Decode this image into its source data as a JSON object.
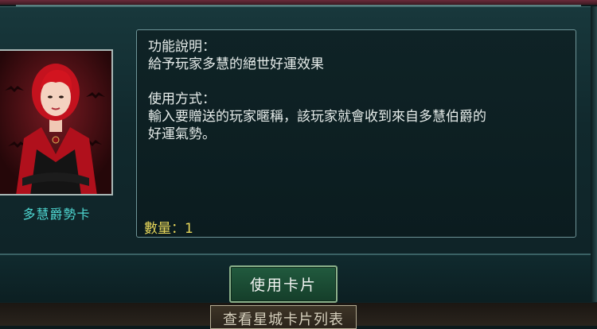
{
  "card": {
    "name": "多慧爵勢卡"
  },
  "description": {
    "function_title": "功能說明：",
    "function_text": "給予玩家多慧的絕世好運效果",
    "usage_title": "使用方式：",
    "usage_text_1": "輸入要贈送的玩家暱稱，該玩家就會收到來自多慧伯爵的",
    "usage_text_2": "好運氣勢。"
  },
  "quantity_label": "數量：1",
  "use_button_label": "使用卡片",
  "card_list_button_label": "查看星城卡片列表",
  "colors": {
    "card_name": "#4fd9d3",
    "quantity": "#e6d65a",
    "button_bg": "#1b4a33"
  }
}
